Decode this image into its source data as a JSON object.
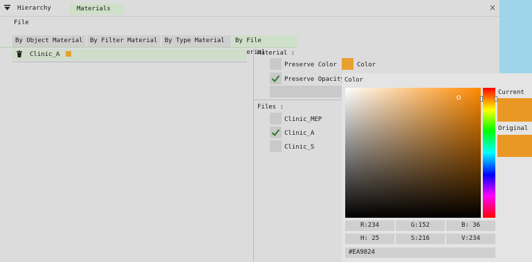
{
  "window": {
    "tabs": [
      {
        "label": "Hierarchy"
      },
      {
        "label": "Materials"
      }
    ],
    "close_glyph": "×"
  },
  "menu": {
    "file": "File"
  },
  "subtabs": [
    "By Object Material",
    "By Filter Material",
    "By Type Material",
    "By File Material"
  ],
  "tree": {
    "item_label": "Clinic_A",
    "item_color": "#e8a030"
  },
  "material": {
    "heading": "Material :",
    "preserve_color": {
      "label": "Preserve Color",
      "checked": false
    },
    "color_button": "Color",
    "preserve_opacity": {
      "label": "Preserve Opacity",
      "checked": true
    }
  },
  "files": {
    "heading": "Files :",
    "items": [
      {
        "label": "Clinic_MEP",
        "checked": false
      },
      {
        "label": "Clinic_A",
        "checked": true
      },
      {
        "label": "Clinic_S",
        "checked": false
      }
    ]
  },
  "picker": {
    "title": "Color",
    "current_label": "Current",
    "original_label": "Original",
    "rgb": [
      "R:234",
      "G:152",
      "B: 36"
    ],
    "hsv": [
      "H: 25",
      "S:216",
      "V:234"
    ],
    "hex": "#EA9824",
    "color": "#EA9824"
  }
}
